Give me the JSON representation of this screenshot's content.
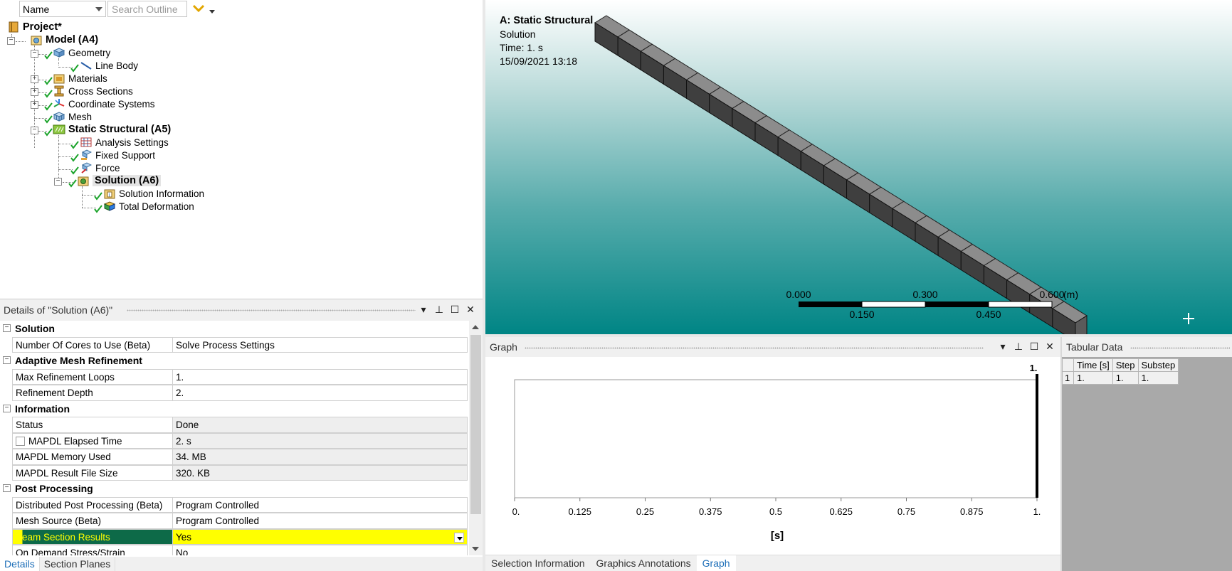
{
  "outline": {
    "name_filter": "Name",
    "search_placeholder": "Search Outline",
    "tree": {
      "project": "Project*",
      "model": "Model (A4)",
      "geometry": "Geometry",
      "line_body": "Line Body",
      "materials": "Materials",
      "cross_sections": "Cross Sections",
      "coordinate_systems": "Coordinate Systems",
      "mesh": "Mesh",
      "static_structural": "Static Structural (A5)",
      "analysis_settings": "Analysis Settings",
      "fixed_support": "Fixed Support",
      "force": "Force",
      "solution": "Solution (A6)",
      "solution_information": "Solution Information",
      "total_deformation": "Total Deformation"
    }
  },
  "details": {
    "title": "Details of \"Solution (A6)\"",
    "categories": {
      "solution": "Solution",
      "adaptive": "Adaptive Mesh Refinement",
      "information": "Information",
      "post": "Post Processing"
    },
    "rows": {
      "cores": {
        "key": "Number Of Cores to Use (Beta)",
        "value": "Solve Process Settings"
      },
      "max_loops": {
        "key": "Max Refinement Loops",
        "value": "1."
      },
      "ref_depth": {
        "key": "Refinement Depth",
        "value": "2."
      },
      "status": {
        "key": "Status",
        "value": "Done"
      },
      "elapsed": {
        "key": "MAPDL Elapsed Time",
        "value": "2. s"
      },
      "memory": {
        "key": "MAPDL Memory Used",
        "value": "34. MB"
      },
      "result_size": {
        "key": "MAPDL Result File Size",
        "value": "320. KB"
      },
      "dist_post": {
        "key": "Distributed Post Processing (Beta)",
        "value": "Program Controlled"
      },
      "mesh_source": {
        "key": "Mesh Source (Beta)",
        "value": "Program Controlled"
      },
      "beam_section": {
        "key": "Beam Section Results",
        "value": "Yes"
      },
      "on_demand": {
        "key": "On Demand Stress/Strain",
        "value": "No"
      }
    },
    "tabs": [
      "Details",
      "Section Planes"
    ]
  },
  "viewport": {
    "title": "A: Static Structural",
    "subtitle": "Solution",
    "time": "Time: 1. s",
    "date": "15/09/2021 13:18",
    "scale": {
      "top_labels": [
        "0.000",
        "0.300",
        "0.600"
      ],
      "unit": "(m)",
      "bottom_labels": [
        "0.150",
        "0.450"
      ]
    }
  },
  "graph": {
    "title": "Graph",
    "marker_label": "1.",
    "x_ticks": [
      "0.",
      "0.125",
      "0.25",
      "0.375",
      "0.5",
      "0.625",
      "0.75",
      "0.875",
      "1."
    ],
    "x_unit": "[s]",
    "tabs": [
      "Selection Information",
      "Graphics Annotations",
      "Graph"
    ]
  },
  "tabular": {
    "title": "Tabular Data",
    "columns": [
      "Time [s]",
      "Step",
      "Substep"
    ],
    "rows": [
      {
        "index": "1",
        "time": "1.",
        "step": "1.",
        "substep": "1."
      }
    ]
  },
  "colors": {
    "highlight": "#ffff00",
    "tab_active": "#1e6fb8",
    "viewport_bottom": "#008585"
  }
}
